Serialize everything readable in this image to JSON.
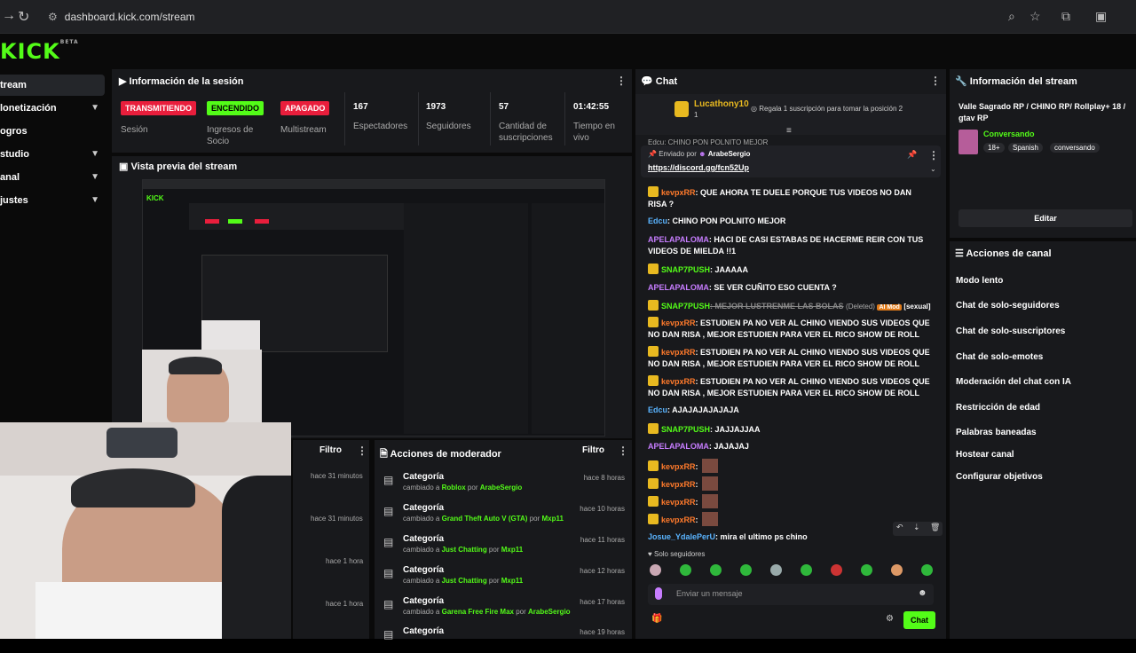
{
  "browser": {
    "url": "dashboard.kick.com/stream"
  },
  "logo": {
    "text": "KICK",
    "sub": "BETA"
  },
  "sidebar": {
    "items": [
      {
        "label": "tream"
      },
      {
        "label": "lonetización"
      },
      {
        "label": "ogros"
      },
      {
        "label": "studio"
      },
      {
        "label": "anal"
      },
      {
        "label": "justes"
      }
    ]
  },
  "session": {
    "title": "Información de la sesión",
    "stats": [
      {
        "badge": "TRANSMITIENDO",
        "label": "Sesión"
      },
      {
        "badge": "ENCENDIDO",
        "label": "Ingresos de Socio"
      },
      {
        "badge": "APAGADO",
        "label": "Multistream"
      },
      {
        "value": "167",
        "label": "Espectadores"
      },
      {
        "value": "1973",
        "label": "Seguidores"
      },
      {
        "value": "57",
        "label": "Cantidad de suscripciones"
      },
      {
        "value": "01:42:55",
        "label": "Tiempo en vivo"
      }
    ]
  },
  "preview": {
    "title": "Vista previa del stream"
  },
  "filter_left": {
    "label": "Filtro",
    "times": [
      "hace 31 minutos",
      "hace 31 minutos",
      "hace 1 hora",
      "hace 1 hora"
    ]
  },
  "mod_actions": {
    "title": "Acciones de moderador",
    "filter": "Filtro",
    "rows": [
      {
        "title": "Categoría",
        "prefix": "cambiado a ",
        "category": "Roblox",
        "by": " por ",
        "user": "ArabeSergio",
        "time": "hace 8 horas"
      },
      {
        "title": "Categoría",
        "prefix": "cambiado a ",
        "category": "Grand Theft Auto V (GTA)",
        "by": " por ",
        "user": "Mxp11",
        "time": "hace 10 horas"
      },
      {
        "title": "Categoría",
        "prefix": "cambiado a ",
        "category": "Just Chatting",
        "by": " por ",
        "user": "Mxp11",
        "time": "hace 11 horas"
      },
      {
        "title": "Categoría",
        "prefix": "cambiado a ",
        "category": "Just Chatting",
        "by": " por ",
        "user": "Mxp11",
        "time": "hace 12 horas"
      },
      {
        "title": "Categoría",
        "prefix": "cambiado a ",
        "category": "Garena Free Fire Max",
        "by": " por ",
        "user": "ArabeSergio",
        "time": "hace 17 horas"
      },
      {
        "title": "Categoría",
        "time": "hace 19 horas"
      }
    ]
  },
  "chat": {
    "title": "Chat",
    "gift_user": "Lucathony10",
    "gift_count": "1",
    "gift_text": "Regala 1 suscripción para tomar la posición 2",
    "pinned_cut": "Edcu: CHINO PON POLNITO MEJOR",
    "pinned_by_label": "Enviado por",
    "pinned_by_user": "ArabeSergio",
    "pinned_link": "https://discord.gg/fcn52Up",
    "messages": [
      {
        "user": "kevpxRR",
        "text": ": QUE AHORA TE DUELE PORQUE TUS VIDEOS NO DAN RISA ?",
        "color": "#ff7a2b"
      },
      {
        "user": "Edcu",
        "text": ": CHINO PON POLNITO MEJOR",
        "color": "#5ab4ff"
      },
      {
        "user": "APELAPALOMA",
        "text": ": HACI DE CASI ESTABAS DE HACERME REIR CON TUS VIDEOS DE MIELDA !!1",
        "color": "#c77dff"
      },
      {
        "user": "SNAP7PUSH",
        "text": ": JAAAAA",
        "color": "#53fc18"
      },
      {
        "user": "APELAPALOMA",
        "text": ": SE VER CUÑITO ESO CUENTA ?",
        "color": "#c77dff"
      },
      {
        "user": "SNAP7PUSH",
        "text": ": MEJOR LUSTRENME LAS BOLAS",
        "deleted": "(Deleted)",
        "tag": "AI Mod",
        "reason": "[sexual]",
        "color": "#53fc18"
      },
      {
        "user": "kevpxRR",
        "text": ": ESTUDIEN PA NO VER AL CHINO VIENDO SUS VIDEOS QUE NO DAN RISA , MEJOR ESTUDIEN PARA VER EL RICO SHOW DE ROLL",
        "color": "#ff7a2b"
      },
      {
        "user": "kevpxRR",
        "text": ": ESTUDIEN PA NO VER AL CHINO VIENDO SUS VIDEOS QUE NO DAN RISA , MEJOR ESTUDIEN PARA VER EL RICO SHOW DE ROLL",
        "color": "#ff7a2b"
      },
      {
        "user": "kevpxRR",
        "text": ": ESTUDIEN PA NO VER AL CHINO VIENDO SUS VIDEOS QUE NO DAN RISA , MEJOR ESTUDIEN PARA VER EL RICO SHOW DE ROLL",
        "color": "#ff7a2b"
      },
      {
        "user": "Edcu",
        "text": ": AJAJAJAJAJAJA",
        "color": "#5ab4ff"
      },
      {
        "user": "SNAP7PUSH",
        "text": ": JAJJAJJAA",
        "color": "#53fc18"
      },
      {
        "user": "APELAPALOMA",
        "text": ": JAJAJAJ",
        "color": "#c77dff"
      },
      {
        "user": "kevpxRR",
        "text": ":",
        "color": "#ff7a2b"
      },
      {
        "user": "kevpxRR",
        "text": ":",
        "color": "#ff7a2b"
      },
      {
        "user": "kevpxRR",
        "text": ":",
        "color": "#ff7a2b"
      },
      {
        "user": "kevpxRR",
        "text": ":",
        "color": "#ff7a2b"
      },
      {
        "user": "Josue_YdalePerU",
        "text": ": mira el ultimo ps chino",
        "color": "#5ab4ff"
      }
    ],
    "followers_only": "Solo seguidores",
    "input_placeholder": "Enviar un mensaje",
    "send_label": "Chat"
  },
  "stream_info": {
    "title": "Información del stream",
    "stream_title": "Valle Sagrado RP / CHINO RP/ Rollplay+ 18 / gtav RP",
    "category": "Conversando",
    "tags": [
      "18+",
      "Spanish",
      "conversando"
    ],
    "edit_label": "Editar"
  },
  "channel_actions": {
    "title": "Acciones de canal",
    "items": [
      "Modo lento",
      "Chat de solo-seguidores",
      "Chat de solo-suscriptores",
      "Chat de solo-emotes",
      "Moderación del chat con IA",
      "Restricción de edad",
      "Palabras baneadas",
      "Hostear canal",
      "Configurar objetivos"
    ]
  },
  "colors": {
    "accent": "#53fc18",
    "live": "#e91e3c",
    "panel": "#18191c"
  }
}
